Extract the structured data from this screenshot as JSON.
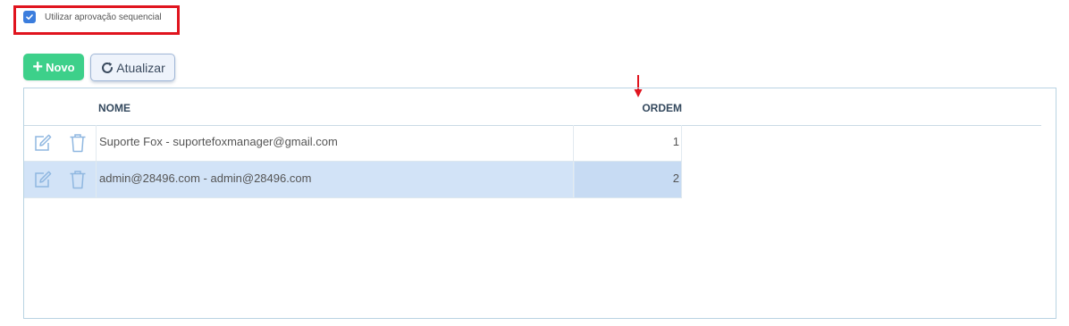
{
  "options": {
    "sequential_approval": {
      "label": "Utilizar aprovação sequencial",
      "checked": true
    }
  },
  "toolbar": {
    "new_label": "Novo",
    "refresh_label": "Atualizar"
  },
  "grid": {
    "columns": {
      "name": "NOME",
      "order": "ORDEM"
    },
    "rows": [
      {
        "name": "Suporte Fox - suportefoxmanager@gmail.com",
        "order": "1",
        "selected": false
      },
      {
        "name": "admin@28496.com - admin@28496.com",
        "order": "2",
        "selected": true
      }
    ]
  },
  "colors": {
    "accent_green": "#3dd08a",
    "checkbox_blue": "#3b7ddd",
    "highlight_red": "#e0141e",
    "row_selected": "#d2e3f7"
  },
  "icons": {
    "checkbox": "check-icon",
    "new": "plus-icon",
    "refresh": "refresh-icon",
    "edit": "edit-icon",
    "delete": "trash-icon",
    "annotation": "arrow-down-icon"
  }
}
